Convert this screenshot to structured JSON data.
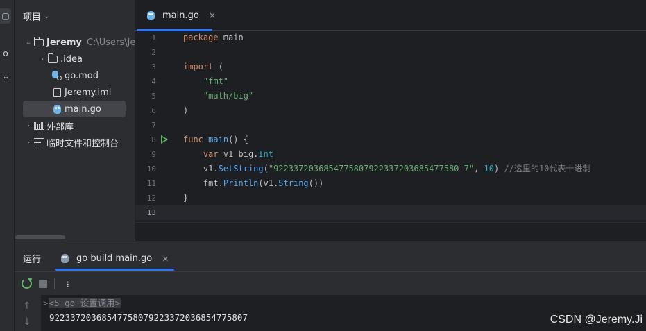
{
  "project_panel": {
    "title": "项目",
    "tree": [
      {
        "label": "Jeremy",
        "path": "C:\\Users\\Jeremy",
        "expanded": true
      },
      {
        "label": ".idea"
      },
      {
        "label": "go.mod"
      },
      {
        "label": "Jeremy.iml"
      },
      {
        "label": "main.go",
        "selected": true
      },
      {
        "label": "外部库"
      },
      {
        "label": "临时文件和控制台"
      }
    ]
  },
  "editor": {
    "tab_label": "main.go",
    "tab_close": "×",
    "line_numbers": [
      "1",
      "2",
      "3",
      "4",
      "5",
      "6",
      "7",
      "8",
      "9",
      "10",
      "11",
      "12",
      "13"
    ],
    "current_line": 13,
    "run_gutter_line": 8,
    "code": {
      "l1_kw": "package",
      "l1_rest": " main",
      "l3_kw": "import",
      "l3_rest": " (",
      "l4_str": "\"fmt\"",
      "l5_str": "\"math/big\"",
      "l6": ")",
      "l8_kw": "func",
      "l8_fn": "main",
      "l8_rest": "() {",
      "l9_kw": "var",
      "l9_mid": " v1 big.",
      "l9_typ": "Int",
      "l10_pre": "v1.",
      "l10_fn": "SetString",
      "l10_open": "(",
      "l10_str": "\"9223372036854775807922337203685477580 7\"",
      "l10_comma": ", ",
      "l10_num": "10",
      "l10_close": ") ",
      "l10_cmt": "//这里的10代表十进制",
      "l11_pre": "fmt.",
      "l11_fn": "Println",
      "l11_mid": "(v1.",
      "l11_fn2": "String",
      "l11_end": "())",
      "l12": "}"
    }
  },
  "run_panel": {
    "title": "运行",
    "tab_label": "go build main.go",
    "tab_close": "×",
    "console_cmd": "<5 go 设置调用>",
    "console_prompt": ">",
    "console_output": "92233720368547758079223372036854775807"
  },
  "watermark": "CSDN @Jeremy.Ji"
}
